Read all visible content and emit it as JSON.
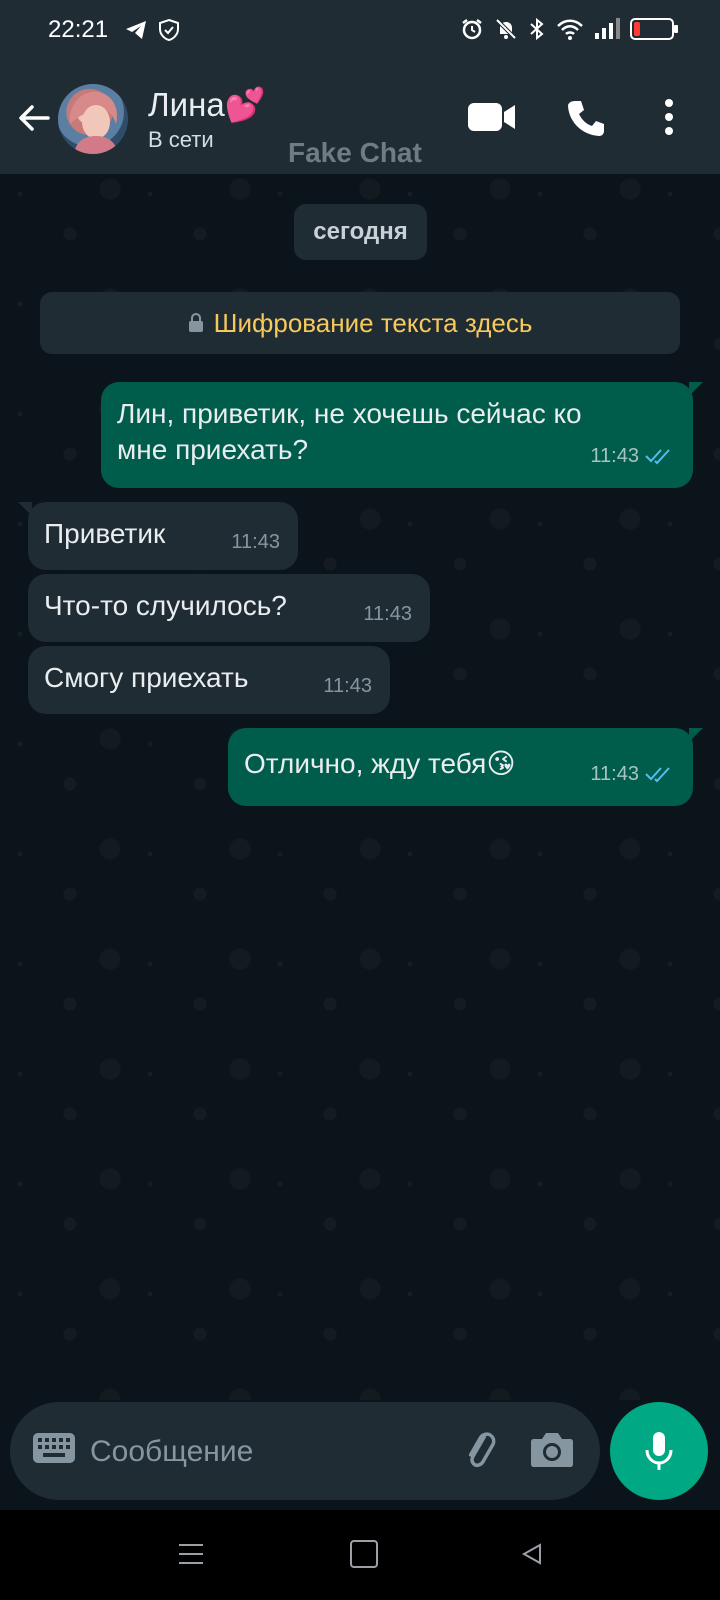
{
  "status_bar": {
    "time": "22:21",
    "left_icons": [
      "telegram-icon",
      "shield-icon"
    ],
    "right_icons": [
      "alarm-icon",
      "mute-icon",
      "bluetooth-icon",
      "wifi-icon",
      "signal-icon",
      "battery-icon"
    ],
    "battery_level_fraction": 0.15,
    "battery_color": "#ff3b30"
  },
  "header": {
    "contact_name": "Лина💕",
    "contact_status": "В сети",
    "watermark": "Fake Chat",
    "icons": [
      "back-arrow-icon",
      "video-call-icon",
      "phone-icon",
      "more-vert-icon"
    ]
  },
  "chat": {
    "date_label": "сегодня",
    "encryption_notice": "Шифрование текста здесь",
    "messages": [
      {
        "direction": "outgoing",
        "text_line1": "Лин, приветик, не хочешь сейчас ко",
        "text_line2": "мне приехать?",
        "time": "11:43",
        "read": true
      },
      {
        "direction": "incoming",
        "text": "Приветик",
        "time": "11:43"
      },
      {
        "direction": "incoming",
        "text": "Что-то случилось?",
        "time": "11:43"
      },
      {
        "direction": "incoming",
        "text": "Смогу приехать",
        "time": "11:43"
      },
      {
        "direction": "outgoing",
        "text": "Отлично, жду тебя😘",
        "time": "11:43",
        "read": true
      }
    ]
  },
  "composer": {
    "placeholder": "Сообщение",
    "value": ""
  },
  "colors": {
    "background": "#0b141a",
    "header": "#1f2c34",
    "outgoing_bubble": "#005c4b",
    "incoming_bubble": "#1f2c34",
    "accent": "#00a884",
    "encryption_text": "#f7c95d",
    "read_ticks": "#53bdeb"
  }
}
